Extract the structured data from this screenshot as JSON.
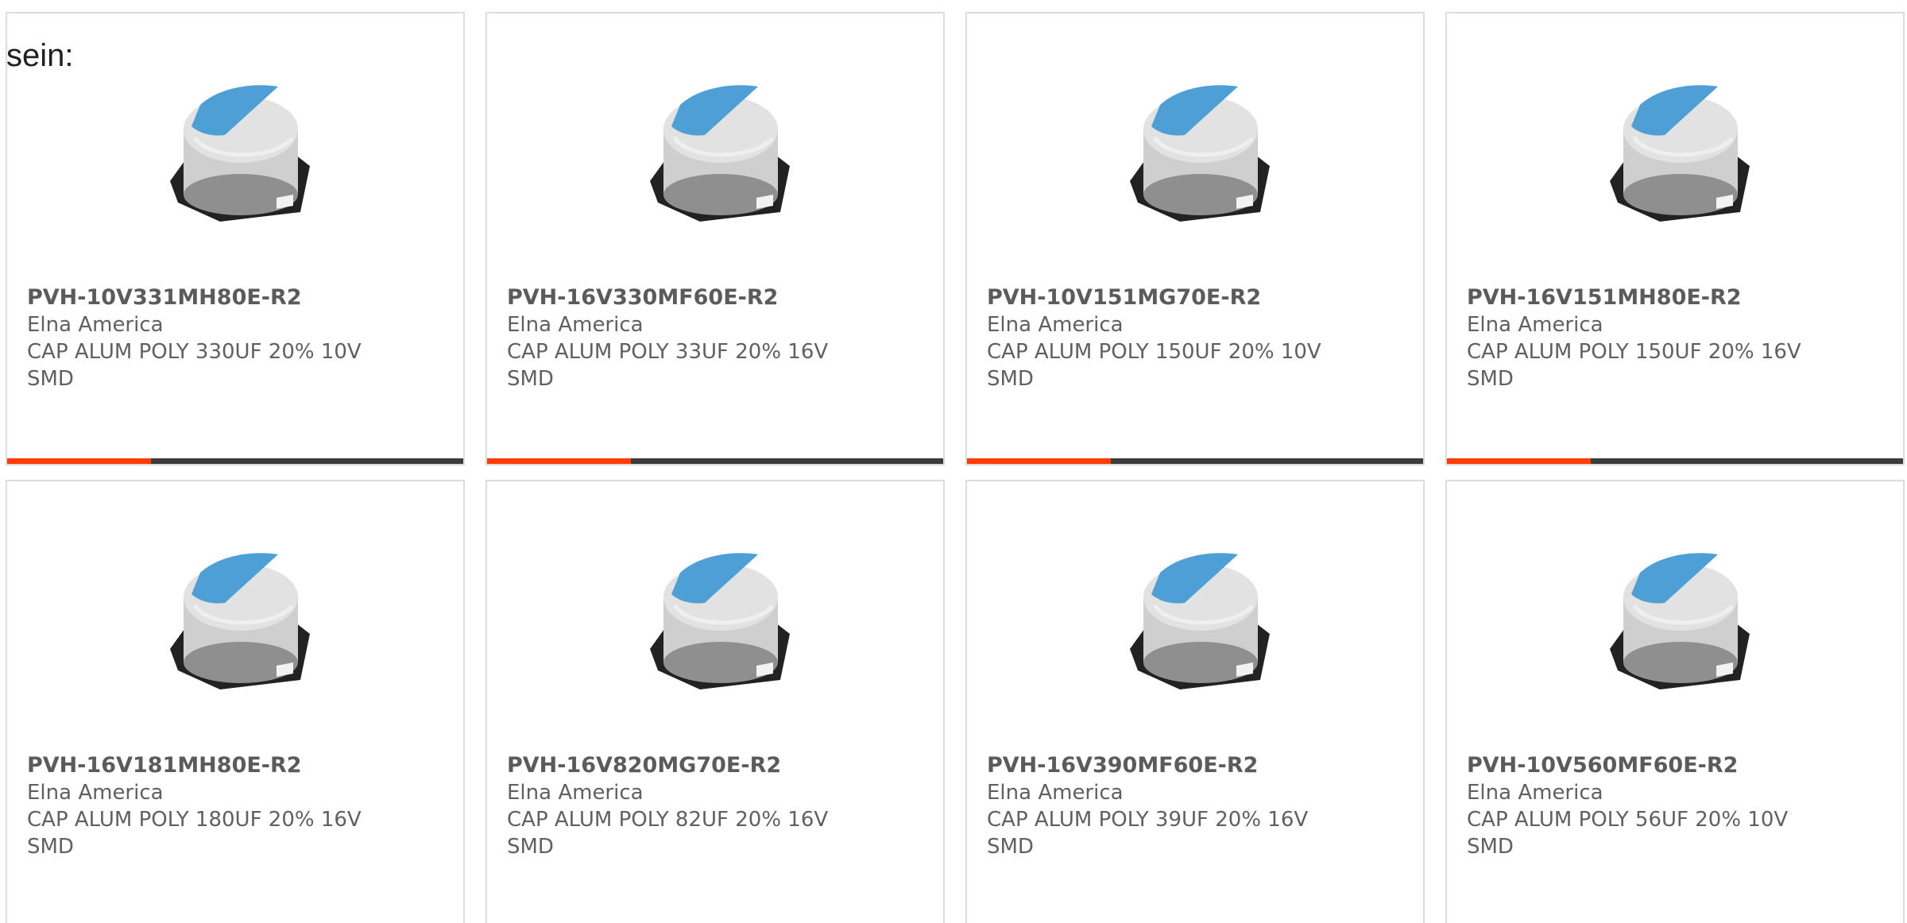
{
  "page": {
    "lead_text": "sein:"
  },
  "colors": {
    "card_border": "#dcdcdc",
    "part_number_text": "#5b5b5b",
    "body_text": "#606060",
    "progress_track": "#3c3c3c",
    "progress_fill": "#ff3d00",
    "capacitor_top": "#4f9fd7",
    "capacitor_can": "#d7d7d7",
    "capacitor_base": "#222222"
  },
  "products": [
    {
      "part_number": "PVH-10V331MH80E-R2",
      "manufacturer": "Elna America",
      "description_line1": "CAP ALUM POLY 330UF 20% 10V",
      "description_line2": "SMD",
      "image_icon": "aluminum-polymer-capacitor-icon",
      "progress_fraction": 0.315
    },
    {
      "part_number": "PVH-16V330MF60E-R2",
      "manufacturer": "Elna America",
      "description_line1": "CAP ALUM POLY 33UF 20% 16V",
      "description_line2": "SMD",
      "image_icon": "aluminum-polymer-capacitor-icon",
      "progress_fraction": 0.315
    },
    {
      "part_number": "PVH-10V151MG70E-R2",
      "manufacturer": "Elna America",
      "description_line1": "CAP ALUM POLY 150UF 20% 10V",
      "description_line2": "SMD",
      "image_icon": "aluminum-polymer-capacitor-icon",
      "progress_fraction": 0.315
    },
    {
      "part_number": "PVH-16V151MH80E-R2",
      "manufacturer": "Elna America",
      "description_line1": "CAP ALUM POLY 150UF 20% 16V",
      "description_line2": "SMD",
      "image_icon": "aluminum-polymer-capacitor-icon",
      "progress_fraction": 0.315
    },
    {
      "part_number": "PVH-16V181MH80E-R2",
      "manufacturer": "Elna America",
      "description_line1": "CAP ALUM POLY 180UF 20% 16V",
      "description_line2": "SMD",
      "image_icon": "aluminum-polymer-capacitor-icon"
    },
    {
      "part_number": "PVH-16V820MG70E-R2",
      "manufacturer": "Elna America",
      "description_line1": "CAP ALUM POLY 82UF 20% 16V",
      "description_line2": "SMD",
      "image_icon": "aluminum-polymer-capacitor-icon"
    },
    {
      "part_number": "PVH-16V390MF60E-R2",
      "manufacturer": "Elna America",
      "description_line1": "CAP ALUM POLY 39UF 20% 16V",
      "description_line2": "SMD",
      "image_icon": "aluminum-polymer-capacitor-icon"
    },
    {
      "part_number": "PVH-10V560MF60E-R2",
      "manufacturer": "Elna America",
      "description_line1": "CAP ALUM POLY 56UF 20% 10V",
      "description_line2": "SMD",
      "image_icon": "aluminum-polymer-capacitor-icon"
    }
  ]
}
